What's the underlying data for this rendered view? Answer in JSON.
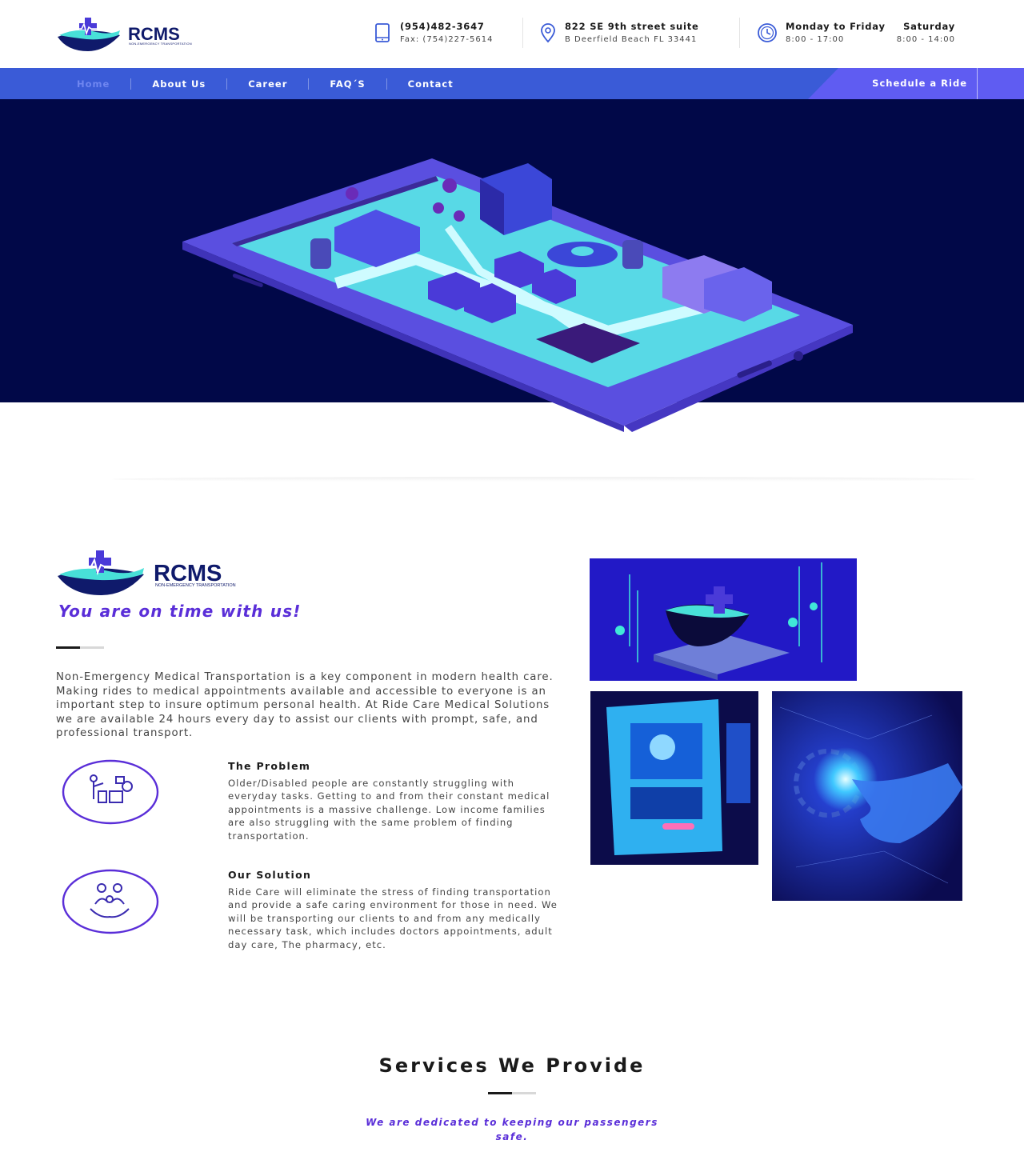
{
  "header": {
    "brand": "RCMS",
    "brand_sub": "NON-EMERGENCY TRANSPORTATION",
    "phone": "(954)482-3647",
    "fax": "Fax: (754)227-5614",
    "address_line1": "822 SE 9th street suite",
    "address_line2": "B Deerfield Beach FL 33441",
    "hours_weekday_label": "Monday to Friday",
    "hours_weekday": "8:00 - 17:00",
    "hours_saturday_label": "Saturday",
    "hours_saturday": "8:00 - 14:00"
  },
  "nav": {
    "items": [
      {
        "label": "Home"
      },
      {
        "label": "About Us"
      },
      {
        "label": "Career"
      },
      {
        "label": "FAQ´S"
      },
      {
        "label": "Contact"
      }
    ],
    "cta": "Schedule a Ride"
  },
  "about": {
    "brand": "RCMS",
    "brand_sub": "NON-EMERGENCY TRANSPORTATION",
    "tagline": "You are on time with us!",
    "intro": "Non-Emergency Medical Transportation is a key component in modern health care. Making rides to medical appointments available and accessible to everyone is an important step to insure optimum personal health. At Ride Care Medical Solutions we are available 24 hours every day to assist our clients with prompt, safe, and professional transport.",
    "features": [
      {
        "title": "The Problem",
        "text": "Older/Disabled people are constantly struggling with everyday tasks. Getting to and from their constant medical appointments is a massive challenge. Low income families are also struggling with the same problem of finding transportation."
      },
      {
        "title": "Our Solution",
        "text": "Ride Care will eliminate the stress of finding transportation and provide a safe caring environment for those in need. We will be transporting our clients to and from any medically necessary task, which includes doctors appointments, adult day care, The pharmacy, etc."
      }
    ]
  },
  "services": {
    "title": "Services We Provide",
    "subtitle": "We are dedicated to keeping our passengers safe."
  },
  "colors": {
    "nav_bg": "#3a5bd7",
    "cta_bg": "#5f5cf2",
    "hero_bg": "#010848",
    "accent_purple": "#5a2ed8"
  },
  "icons": [
    "logo-mark",
    "phone-icon",
    "location-pin-icon",
    "clock-icon",
    "problem-icon",
    "solution-family-icon"
  ]
}
